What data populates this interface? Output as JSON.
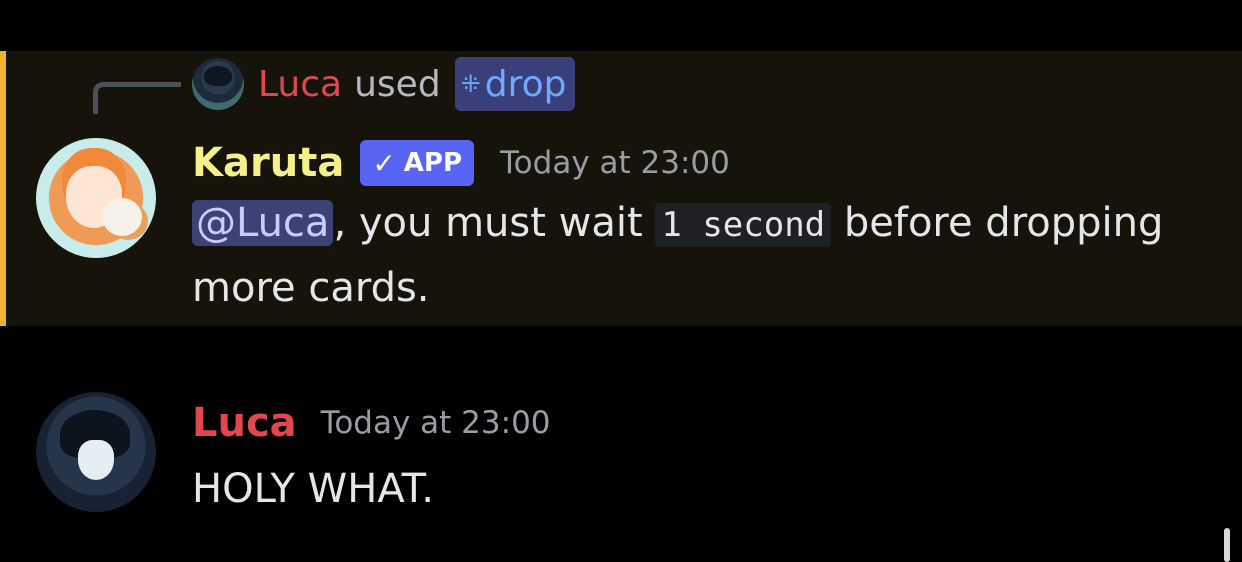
{
  "reply_context": {
    "user": "Luca",
    "verb": "used",
    "command": "drop",
    "command_icon": "slash-command-icon"
  },
  "messages": [
    {
      "author": "Karuta",
      "badge": "APP",
      "timestamp": "Today at 23:00",
      "mention": "@Luca",
      "text_after_mention": ", you must wait",
      "code": "1 second",
      "text_after_code": "before dropping more cards.",
      "highlighted": true
    },
    {
      "author": "Luca",
      "timestamp": "Today at 23:00",
      "text": "HOLY WHAT."
    }
  ],
  "colors": {
    "background": "#000000",
    "mention_highlight_bg": "#16130b",
    "mention_highlight_bar": "#f0b232",
    "bot_username": "#f6f08b",
    "luca_username": "#e0474f",
    "app_badge": "#5865f2",
    "mention_pill": "#3c4275",
    "command_chip": "#3a3f7a"
  }
}
